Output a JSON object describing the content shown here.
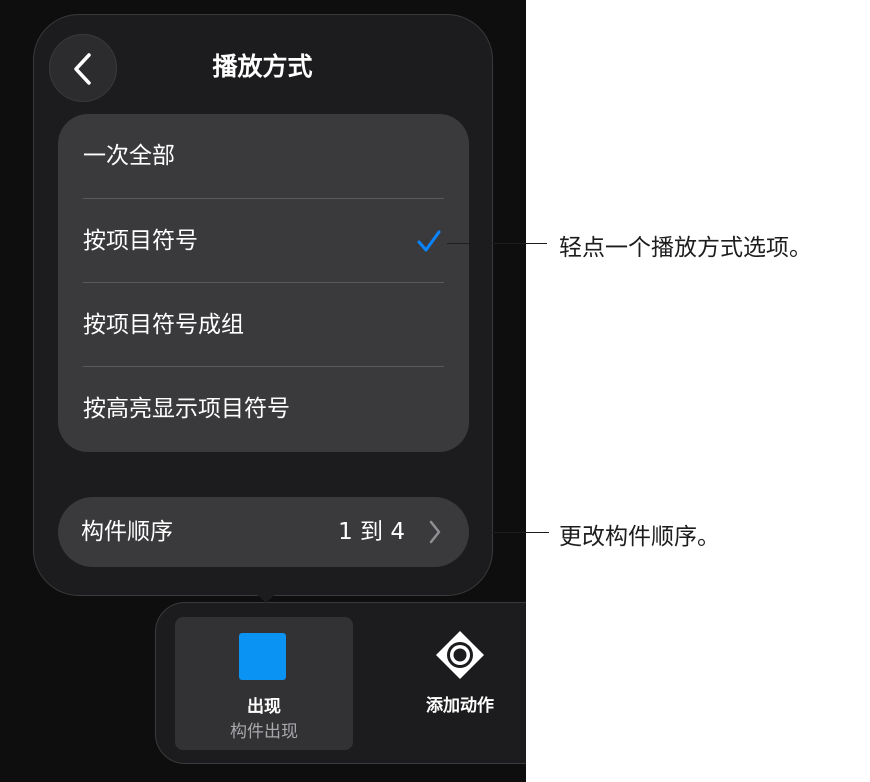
{
  "popover": {
    "title": "播放方式",
    "options": [
      {
        "label": "一次全部",
        "selected": false
      },
      {
        "label": "按项目符号",
        "selected": true
      },
      {
        "label": "按项目符号成组",
        "selected": false
      },
      {
        "label": "按高亮显示项目符号",
        "selected": false
      }
    ],
    "order_label": "构件顺序",
    "order_value": "1 到 4"
  },
  "toolbar": {
    "appear_title": "出现",
    "appear_subtitle": "构件出现",
    "add_action_label": "添加动作"
  },
  "callouts": {
    "select_option": "轻点一个播放方式选项。",
    "change_order": "更改构件顺序。"
  },
  "colors": {
    "accent": "#0a84ff",
    "appear_swatch": "#0a93f2",
    "panel": "#1c1c1e",
    "option_bg": "#3a3a3c"
  },
  "icons": {
    "back": "chevron-left-icon",
    "check": "checkmark-icon",
    "disclosure": "chevron-right-icon",
    "add_action": "action-diamond-icon"
  }
}
